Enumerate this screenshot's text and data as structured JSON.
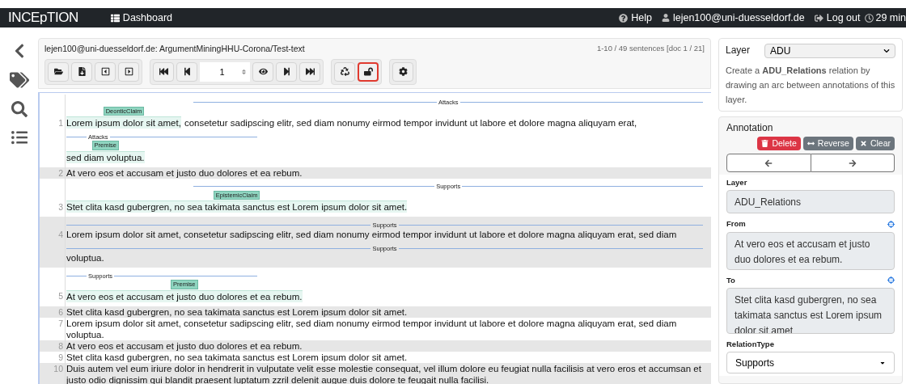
{
  "navbar": {
    "brand": "INCEpTION",
    "dashboard": "Dashboard",
    "help": "Help",
    "user": "lejen100@uni-duesseldorf.de",
    "logout": "Log out",
    "timer": "29 min"
  },
  "document": {
    "title": "lejen100@uni-duesseldorf.de: ArgumentMiningHHU-Corona/Test-text",
    "counter": "1-10 / 49 sentences [doc 1 / 21]"
  },
  "toolbar": {
    "page": "1",
    "lock_highlighted": true
  },
  "sentences": [
    {
      "number": "1",
      "shaded": false,
      "lines": [
        {
          "arc": {
            "label": "Attacks",
            "kind": "right"
          },
          "segments": [
            {
              "text": "Lorem ipsum dolor sit amet,",
              "tag": "DeonticClaim"
            },
            {
              "text": "consetetur sadipscing elitr, sed diam nonumy eirmod tempor invidunt ut labore et dolore magna aliquyam erat,"
            }
          ]
        },
        {
          "arc": {
            "label": "Attacks",
            "kind": "left"
          },
          "segments": [
            {
              "text": "sed diam voluptua.",
              "tag": "Premise"
            }
          ]
        }
      ]
    },
    {
      "number": "2",
      "shaded": true,
      "lines": [
        {
          "segments": [
            {
              "text": "At vero eos et accusam et justo duo dolores et ea rebum."
            }
          ]
        }
      ]
    },
    {
      "number": "3",
      "shaded": false,
      "lines": [
        {
          "arc": {
            "label": "Supports",
            "kind": "right"
          },
          "segments": [
            {
              "text": "Stet clita kasd gubergren, no sea takimata sanctus est Lorem ipsum dolor sit amet.",
              "tag": "EpistemicClaim"
            }
          ]
        }
      ]
    },
    {
      "number": "4",
      "shaded": true,
      "lines": [
        {
          "arc": {
            "label": "Supports",
            "kind": "full"
          },
          "segments": [
            {
              "text": "Lorem ipsum dolor sit amet, consetetur sadipscing elitr, sed diam nonumy eirmod tempor invidunt ut labore et dolore magna aliquyam erat, sed diam"
            }
          ]
        },
        {
          "arc": {
            "label": "Supports",
            "kind": "full"
          },
          "segments": [
            {
              "text": "voluptua."
            }
          ]
        }
      ]
    },
    {
      "number": "5",
      "shaded": false,
      "lines": [
        {
          "arc": {
            "label": "Supports",
            "kind": "left"
          },
          "segments": [
            {
              "text": "At vero eos et accusam et justo duo dolores et ea rebum.",
              "tag": "Premise"
            }
          ]
        }
      ]
    },
    {
      "number": "6",
      "shaded": true,
      "lines": [
        {
          "segments": [
            {
              "text": "Stet clita kasd gubergren, no sea takimata sanctus est Lorem ipsum dolor sit amet."
            }
          ]
        }
      ]
    },
    {
      "number": "7",
      "shaded": false,
      "lines": [
        {
          "segments": [
            {
              "text": "Lorem ipsum dolor sit amet, consetetur sadipscing elitr, sed diam nonumy eirmod tempor invidunt ut labore et dolore magna aliquyam erat, sed diam voluptua."
            }
          ]
        }
      ]
    },
    {
      "number": "8",
      "shaded": true,
      "lines": [
        {
          "segments": [
            {
              "text": "At vero eos et accusam et justo duo dolores et ea rebum."
            }
          ]
        }
      ]
    },
    {
      "number": "9",
      "shaded": false,
      "lines": [
        {
          "segments": [
            {
              "text": "Stet clita kasd gubergren, no sea takimata sanctus est Lorem ipsum dolor sit amet."
            }
          ]
        }
      ]
    },
    {
      "number": "10",
      "shaded": true,
      "lines": [
        {
          "segments": [
            {
              "text": "Duis autem vel eum iriure dolor in hendrerit in vulputate velit esse molestie consequat, vel illum dolore eu feugiat nulla facilisis at vero eros et accumsan et justo odio dignissim qui blandit praesent luptatum zzril delenit augue duis dolore te feugait nulla facilisi."
            }
          ]
        }
      ]
    }
  ],
  "layer_panel": {
    "label": "Layer",
    "value": "ADU",
    "description": "Create a **ADU_Relations** relation by drawing an arc between annotations of this layer."
  },
  "annotation_panel": {
    "title": "Annotation",
    "buttons": [
      {
        "label": "Delete",
        "kind": "delete"
      },
      {
        "label": "Reverse",
        "kind": "reverse"
      },
      {
        "label": "Clear",
        "kind": "clear"
      }
    ],
    "fields": [
      {
        "label": "Layer",
        "value": "ADU_Relations",
        "kind": "text",
        "locate": false
      },
      {
        "label": "From",
        "value": "At vero eos et accusam et justo duo dolores et ea rebum.",
        "kind": "area",
        "locate": true
      },
      {
        "label": "To",
        "value": "Stet clita kasd gubergren, no sea takimata sanctus est Lorem ipsum dolor sit amet",
        "kind": "area",
        "locate": true
      },
      {
        "label": "RelationType",
        "value": "Supports",
        "kind": "select",
        "locate": false
      }
    ]
  }
}
